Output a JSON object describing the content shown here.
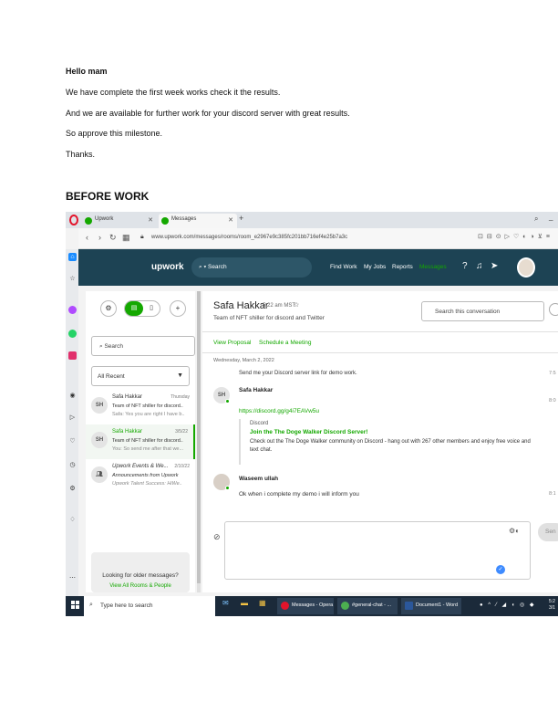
{
  "document": {
    "lines": [
      "Hello mam",
      "We have complete the first week works check it the results.",
      "And we are available for further work for your discord server with great results.",
      "So approve this milestone.",
      "Thanks."
    ],
    "heading": "BEFORE WORK"
  },
  "screenshot": {
    "browser": {
      "tabs": [
        {
          "label": "Upwork"
        },
        {
          "label": "Messages"
        }
      ],
      "url": "www.upwork.com/messages/rooms/room_e2967e9c385fc201bb716ef4e25b7a3c"
    },
    "upwork": {
      "logo": "upwork",
      "search_label": "Search",
      "nav": [
        "Find Work",
        "My Jobs",
        "Reports",
        "Messages"
      ],
      "active_nav": "Messages",
      "search_placeholder": "Search",
      "filter_value": "All Recent",
      "conversations": [
        {
          "initials": "SH",
          "name": "Safa Hakkar",
          "date": "Thursday",
          "line2": "Team of NFT shiller for discord..",
          "line3": "Safa: Yes you are right I have b.."
        },
        {
          "initials": "SH",
          "name": "Safa Hakkar",
          "date": "3/5/22",
          "line2": "Team of NFT shiller for discord..",
          "line3": "You: So send me after that we..."
        },
        {
          "initials": "",
          "name": "Upwork Events & We...",
          "date": "2/10/22",
          "line2": "Announcements from Upwork",
          "line3": "Upwork Talent Success: HiWe.."
        }
      ],
      "older_text": "Looking for older messages?",
      "older_link": "View All Rooms & People",
      "chat": {
        "name": "Safa Hakkar",
        "time": "5:22 am MST",
        "subtitle": "Team of NFT shiller for discord and Twitter",
        "search_placeholder": "Search this conversation",
        "action1": "View Proposal",
        "action2": "Schedule a Meeting",
        "day": "Wednesday, March 2, 2022",
        "cut_message": "Send me your Discord server link for demo work.",
        "cut_time": "7:5",
        "messages": [
          {
            "initials": "SH",
            "sender": "Safa Hakkar",
            "time": "8:0",
            "link": "https://discord.gg/g4i7EAVw5u"
          },
          {
            "initials": "",
            "sender": "Waseem ullah",
            "time": "8:1",
            "body": "Ok when i complete my demo i will inform you"
          }
        ],
        "preview": {
          "site": "Discord",
          "title": "Join the The Doge Walker Discord Server!",
          "desc": "Check out the The Doge Walker community on Discord - hang out with 267 other members and enjoy free voice and text chat."
        },
        "send_label": "Sen"
      }
    },
    "taskbar": {
      "search_placeholder": "Type here to search",
      "tasks": [
        "Messages - Opera",
        "#general-chat - ...",
        "Document1 - Word"
      ],
      "clock_time": "5:2",
      "clock_date": "3/1"
    }
  }
}
